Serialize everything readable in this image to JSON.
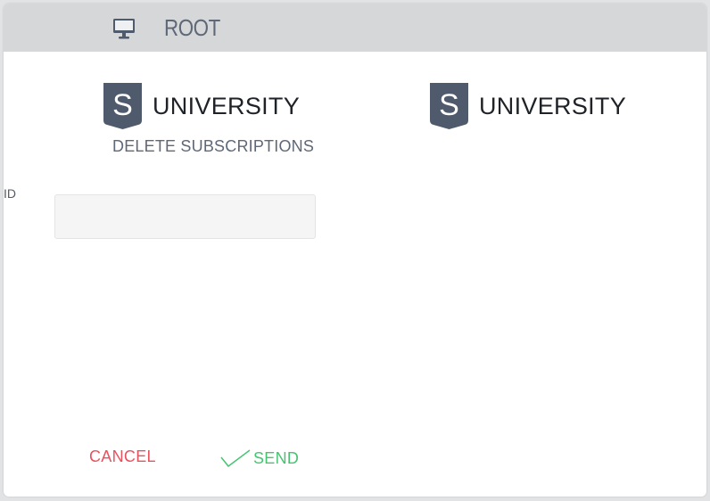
{
  "header": {
    "icon": "monitor-icon",
    "title": "ROOT"
  },
  "left_panel": {
    "logo": {
      "icon": "university-shield-logo",
      "letter": "S",
      "text": "UNIVERSITY"
    },
    "subtitle": "DELETE SUBSCRIPTIONS",
    "form": {
      "id_label": "ID",
      "id_value": "",
      "id_placeholder": ""
    }
  },
  "right_panel": {
    "logo": {
      "icon": "university-shield-logo",
      "letter": "S",
      "text": "UNIVERSITY"
    }
  },
  "actions": {
    "cancel_label": "CANCEL",
    "send_label": "SEND",
    "send_icon": "check-icon"
  },
  "colors": {
    "header_bg": "#d6d7d9",
    "logo_shield": "#4f5a6c",
    "subtitle": "#5f6877",
    "cancel": "#e8525f",
    "send": "#47c472"
  }
}
